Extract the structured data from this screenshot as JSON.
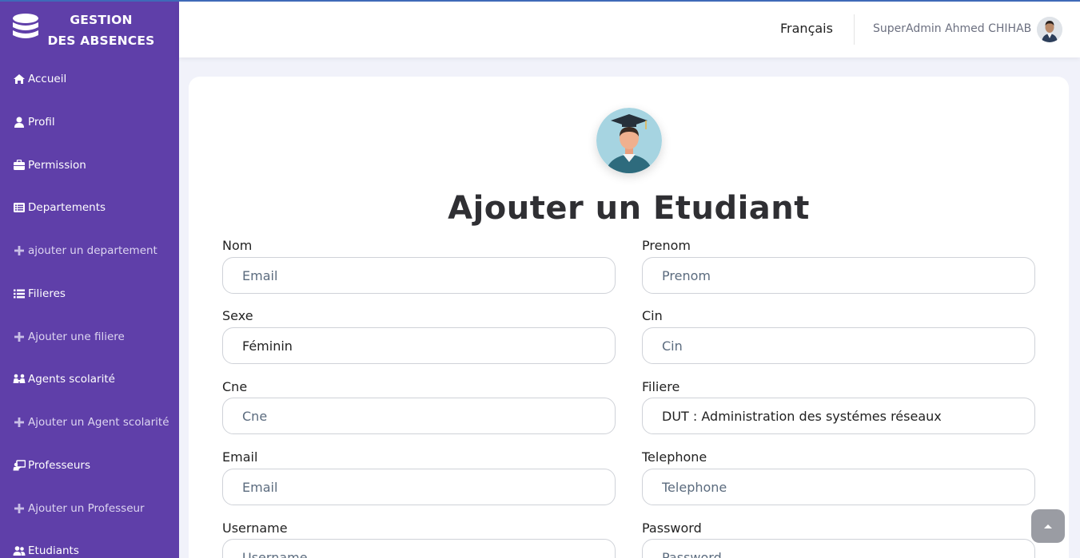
{
  "brand": {
    "line1": "GESTION",
    "line2": "DES ABSENCES",
    "icon": "database-icon"
  },
  "sidebar": {
    "items": [
      {
        "label": "Accueil",
        "icon": "home-icon"
      },
      {
        "label": "Profil",
        "icon": "user-icon"
      },
      {
        "label": "Permission",
        "icon": "briefcase-icon"
      },
      {
        "label": "Departements",
        "icon": "list-alt-icon"
      },
      {
        "label": "ajouter un departement",
        "icon": "plus-icon"
      },
      {
        "label": "Filieres",
        "icon": "list-icon"
      },
      {
        "label": "Ajouter une filiere",
        "icon": "plus-icon"
      },
      {
        "label": "Agents scolarité",
        "icon": "people-icon"
      },
      {
        "label": "Ajouter un Agent scolarité",
        "icon": "plus-icon"
      },
      {
        "label": "Professeurs",
        "icon": "chalkboard-teacher-icon"
      },
      {
        "label": "Ajouter un Professeur",
        "icon": "plus-icon"
      },
      {
        "label": "Etudiants",
        "icon": "users-icon"
      }
    ]
  },
  "header": {
    "language": "Français",
    "user_name": "SuperAdmin Ahmed CHIHAB"
  },
  "form": {
    "title": "Ajouter un Etudiant",
    "nom": {
      "label": "Nom",
      "placeholder": "Email"
    },
    "prenom": {
      "label": "Prenom",
      "placeholder": "Prenom"
    },
    "sexe": {
      "label": "Sexe",
      "value": "Féminin"
    },
    "cin": {
      "label": "Cin",
      "placeholder": "Cin"
    },
    "cne": {
      "label": "Cne",
      "placeholder": "Cne"
    },
    "filiere": {
      "label": "Filiere",
      "value": "DUT : Administration des systémes réseaux"
    },
    "email": {
      "label": "Email",
      "placeholder": "Email"
    },
    "telephone": {
      "label": "Telephone",
      "placeholder": "Telephone"
    },
    "username": {
      "label": "Username",
      "placeholder": "Username"
    },
    "password": {
      "label": "Password",
      "placeholder": "Password"
    }
  },
  "colors": {
    "sidebar_bg": "#5f3fa9",
    "page_bg": "#f1f2fa",
    "top_accent": "#3f6ab8"
  }
}
